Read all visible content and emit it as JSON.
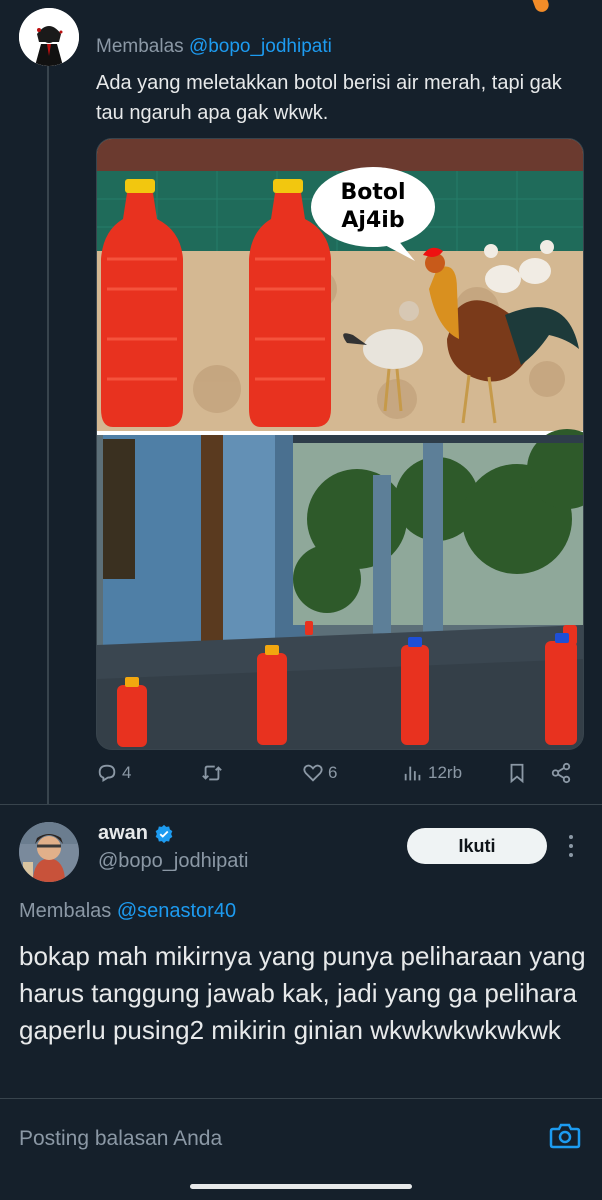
{
  "previous_tweet": {
    "reply_prefix": "Membalas",
    "reply_handle": "@bopo_jodhipati",
    "text": "Ada yang meletakkan botol berisi air merah, tapi gak tau ngaruh apa gak wkwk.",
    "image_bubble_line1": "Botol",
    "image_bubble_line2": "Aj4ib",
    "stats": {
      "replies": "4",
      "likes": "6",
      "views": "12rb"
    }
  },
  "reply_tweet": {
    "display_name": "awan",
    "handle": "@bopo_jodhipati",
    "follow_label": "Ikuti",
    "reply_prefix": "Membalas",
    "reply_handle": "@senastor40",
    "text": "bokap mah mikirnya yang punya peliharaan yang harus tanggung jawab kak, jadi yang ga pelihara gaperlu pusing2 mikirin ginian wkwkwkwkwkwk"
  },
  "composer": {
    "placeholder": "Posting balasan Anda"
  },
  "colors": {
    "background": "#15202b",
    "accent": "#1d9bf0",
    "text_primary": "#e7e9ea",
    "text_secondary": "#8b98a5",
    "verified": "#1d9bf0"
  },
  "icons": [
    "reply-icon",
    "retweet-icon",
    "like-icon",
    "views-icon",
    "bookmark-icon",
    "share-icon",
    "verified-badge-icon",
    "more-options-icon",
    "camera-icon"
  ]
}
